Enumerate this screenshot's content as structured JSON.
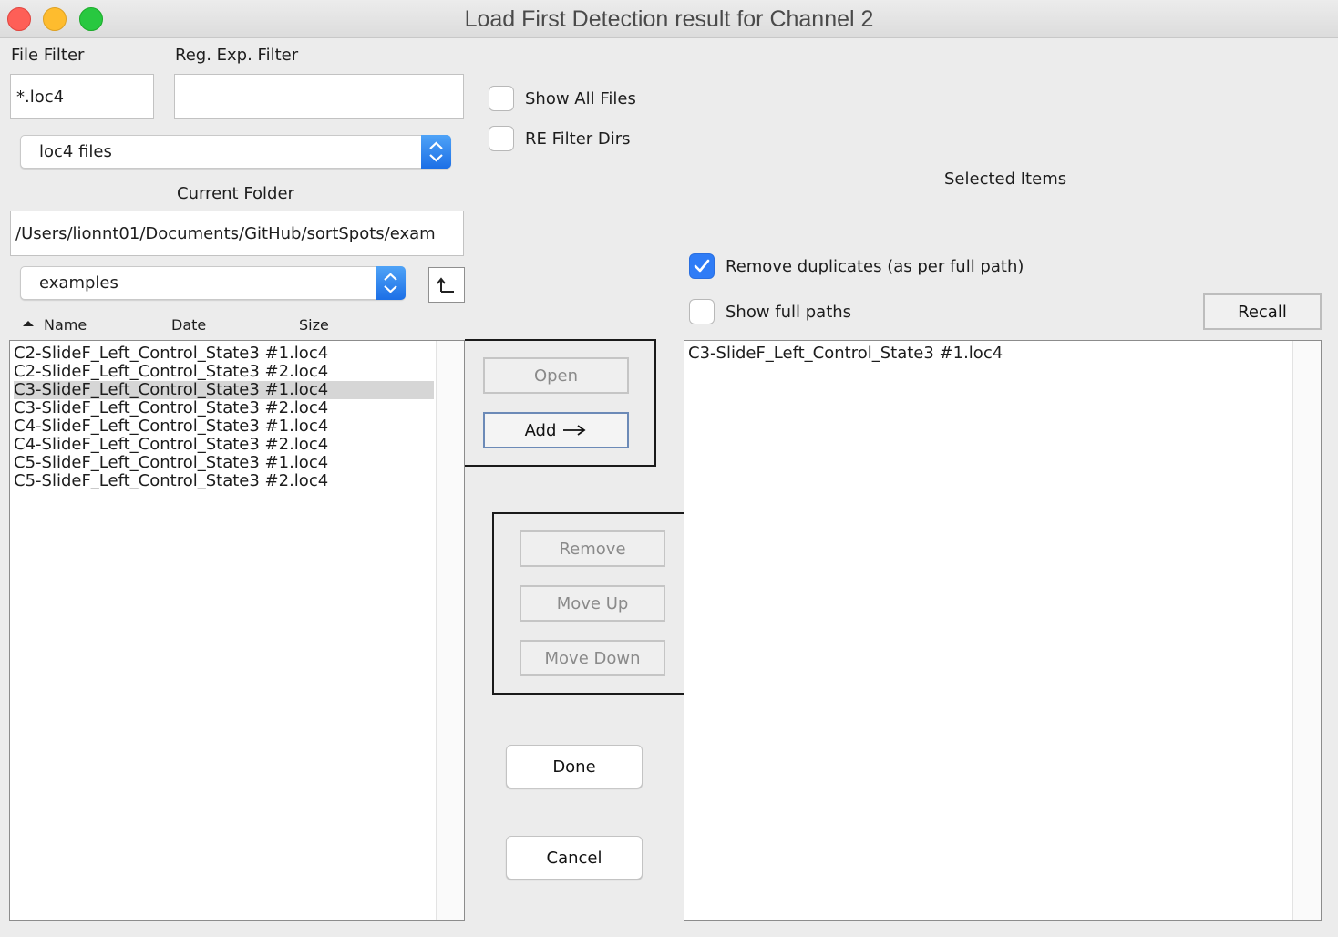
{
  "window": {
    "title": "Load First Detection result for Channel 2"
  },
  "filters": {
    "file_filter_label": "File Filter",
    "file_filter_value": "*.loc4",
    "regex_filter_label": "Reg. Exp. Filter",
    "regex_filter_value": "",
    "file_type": "loc4 files",
    "show_all_files_label": "Show All Files",
    "re_filter_dirs_label": "RE Filter Dirs"
  },
  "folder": {
    "label": "Current Folder",
    "path": "/Users/lionnt01/Documents/GitHub/sortSpots/exam",
    "dropdown_value": "examples"
  },
  "file_list": {
    "columns": [
      "Name",
      "Date",
      "Size"
    ],
    "items": [
      "C2-SlideF_Left_Control_State3 #1.loc4",
      "C2-SlideF_Left_Control_State3 #2.loc4",
      "C3-SlideF_Left_Control_State3 #1.loc4",
      "C3-SlideF_Left_Control_State3 #2.loc4",
      "C4-SlideF_Left_Control_State3 #1.loc4",
      "C4-SlideF_Left_Control_State3 #2.loc4",
      "C5-SlideF_Left_Control_State3 #1.loc4",
      "C5-SlideF_Left_Control_State3 #2.loc4"
    ],
    "selected_index": 2
  },
  "actions": {
    "open": "Open",
    "add": "Add",
    "remove": "Remove",
    "move_up": "Move Up",
    "move_down": "Move Down",
    "done": "Done",
    "cancel": "Cancel"
  },
  "selected": {
    "label": "Selected Items",
    "remove_duplicates_label": "Remove duplicates (as per full path)",
    "remove_duplicates_checked": true,
    "show_full_paths_label": "Show full paths",
    "show_full_paths_checked": false,
    "recall": "Recall",
    "items": [
      "C3-SlideF_Left_Control_State3 #1.loc4"
    ]
  },
  "colors": {
    "accent": "#2f7cf6",
    "selection": "#d6d6d6"
  }
}
